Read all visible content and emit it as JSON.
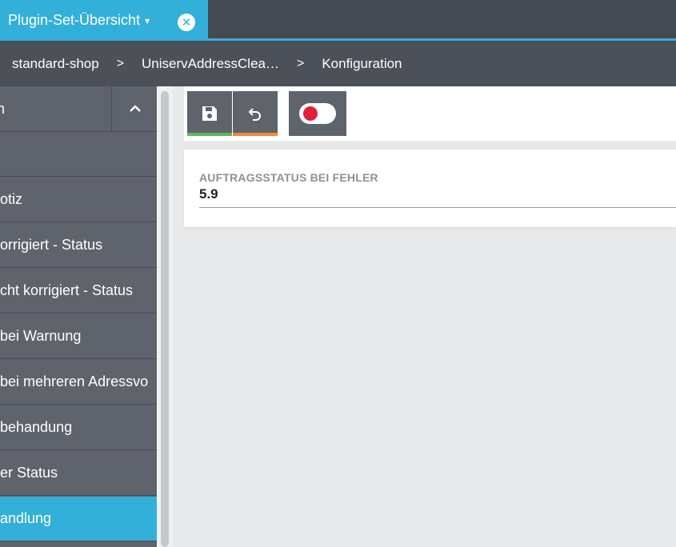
{
  "tabbar": {
    "tab_label": "Plugin-Set-Übersicht",
    "caret": "▾",
    "close": "✕"
  },
  "breadcrumb": {
    "items": [
      "standard-shop",
      "UniservAddressClea…",
      "Konfiguration"
    ],
    "separator": ">"
  },
  "sidebar": {
    "header_text": "n",
    "collapse_icon": "chevron-up-icon",
    "items": [
      {
        "label": ""
      },
      {
        "label": "otiz"
      },
      {
        "label": "orrigiert - Status"
      },
      {
        "label": "cht korrigiert - Status"
      },
      {
        "label": "bei Warnung"
      },
      {
        "label": "bei mehreren Adressvo"
      },
      {
        "label": "behandung"
      },
      {
        "label": "er Status"
      },
      {
        "label": "andlung",
        "active": true
      }
    ]
  },
  "toolbar": {
    "save_icon": "save-icon",
    "undo_icon": "undo-icon",
    "toggle_icon": "toggle-off-icon"
  },
  "form": {
    "field_label": "AUFTRAGSSTATUS BEI FEHLER",
    "field_value": "5.9"
  },
  "colors": {
    "accent": "#33b0d9",
    "dark_bar": "#454952",
    "sidebar": "#5f636b",
    "save_indicator": "#5cb85c",
    "undo_indicator": "#f0883e",
    "toggle_knob": "#e2203b"
  }
}
